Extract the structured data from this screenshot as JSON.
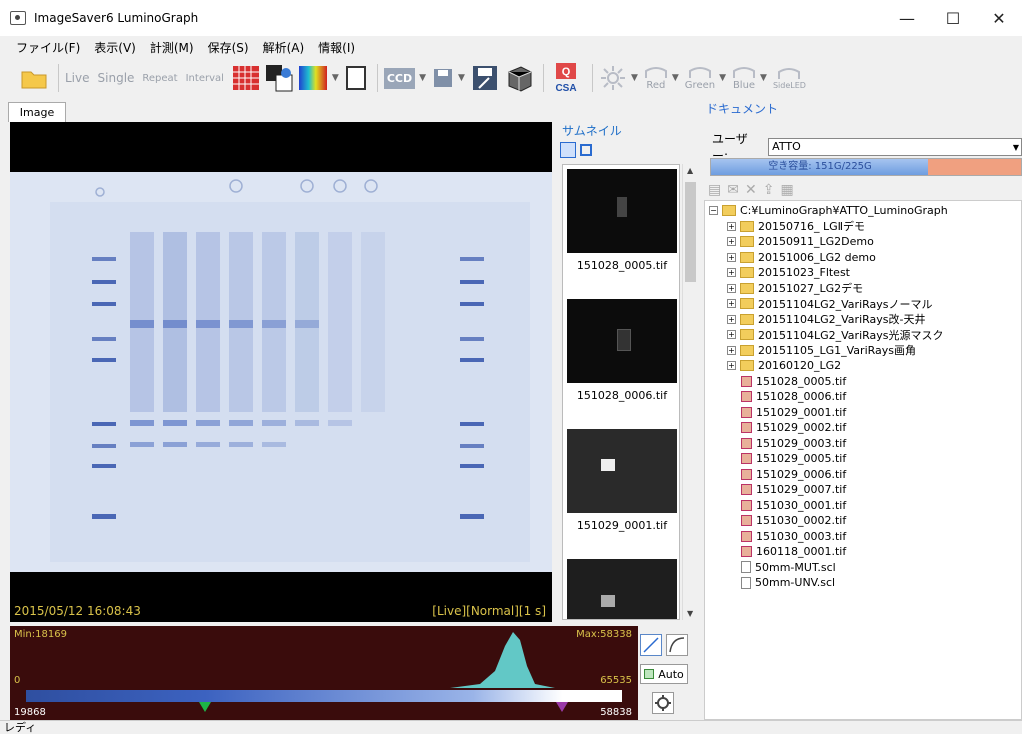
{
  "window": {
    "title": "ImageSaver6 LuminoGraph",
    "minimize": "—",
    "maximize": "☐",
    "close": "✕"
  },
  "menu": [
    "ファイル(F)",
    "表示(V)",
    "計測(M)",
    "保存(S)",
    "解析(A)",
    "情報(I)"
  ],
  "toolbar": {
    "live": "Live",
    "single": "Single",
    "repeat": "Repeat",
    "interval": "Interval",
    "ccd": "CCD",
    "red": "Red",
    "green": "Green",
    "blue": "Blue",
    "side": "SideLED",
    "csa": "CSA"
  },
  "image_tab": "Image",
  "image": {
    "timestamp": "2015/05/12 16:08:43",
    "status": "[Live][Normal][1 s]"
  },
  "thumbnails": {
    "title": "サムネイル",
    "items": [
      {
        "label": "151028_0005.tif"
      },
      {
        "label": "151028_0006.tif"
      },
      {
        "label": "151029_0001.tif"
      },
      {
        "label": ""
      }
    ]
  },
  "document": {
    "title": "ドキュメント",
    "user_label": "ユーザー:",
    "user_value": "ATTO",
    "capacity_text": "空き容量: 151G/225G",
    "capacity_fraction": 0.7,
    "root": "C:¥LuminoGraph¥ATTO_LuminoGraph",
    "folders": [
      "20150716_ LGⅡデモ",
      "20150911_LG2Demo",
      "20151006_LG2 demo",
      "20151023_Fltest",
      "20151027_LG2デモ",
      "20151104LG2_VariRaysノーマル",
      "20151104LG2_VariRays改-天井",
      "20151104LG2_VariRays光源マスク",
      "20151105_LG1_VariRays画角",
      "20160120_LG2"
    ],
    "files": [
      "151028_0005.tif",
      "151028_0006.tif",
      "151029_0001.tif",
      "151029_0002.tif",
      "151029_0003.tif",
      "151029_0005.tif",
      "151029_0006.tif",
      "151029_0007.tif",
      "151030_0001.tif",
      "151030_0002.tif",
      "151030_0003.tif",
      "160118_0001.tif"
    ],
    "scl_files": [
      "50mm-MUT.scl",
      "50mm-UNV.scl"
    ]
  },
  "histogram": {
    "min_label": "Min:18169",
    "max_label": "Max:58338",
    "zero": "0",
    "top": "65535",
    "low_value": "19868",
    "high_value": "58838",
    "low_fraction": 0.3,
    "high_fraction": 0.9
  },
  "auto_label": "Auto",
  "status": "レディ",
  "colors": {
    "accent": "#1f6fc8",
    "gel": "#dfe6f4",
    "band": "#4a67b5",
    "hist": "#62c8c6",
    "overlay_text": "#d9c24a"
  }
}
